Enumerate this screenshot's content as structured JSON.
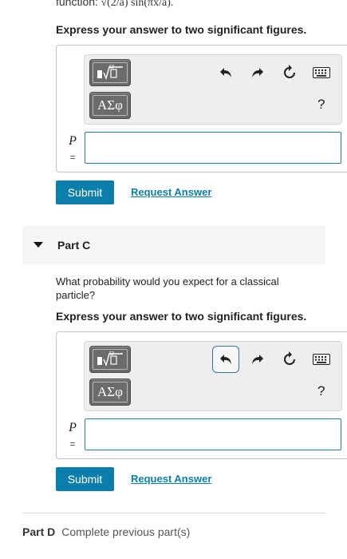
{
  "top_fragment": {
    "prefix": "function:",
    "math": "√(2/a) sin(πx/a)."
  },
  "part_b": {
    "instruction": "Express your answer to two significant figures.",
    "variable": "P",
    "equals": "=",
    "answer_value": "",
    "toolbar": {
      "templates_icon": "templates-icon",
      "symbols_label": "ΑΣφ",
      "help_label": "?"
    },
    "submit_label": "Submit",
    "request_label": "Request Answer"
  },
  "part_c": {
    "title": "Part C",
    "question": "What probability would you expect for a classical particle?",
    "instruction": "Express your answer to two significant figures.",
    "variable": "P",
    "equals": "=",
    "answer_value": "",
    "toolbar": {
      "templates_icon": "templates-icon",
      "symbols_label": "ΑΣφ",
      "help_label": "?"
    },
    "submit_label": "Submit",
    "request_label": "Request Answer"
  },
  "part_d": {
    "title": "Part D",
    "status": "Complete previous part(s)"
  },
  "colors": {
    "accent": "#0c7eab",
    "tool_button": "#6b6b6b",
    "toolbar_bg": "#eeeeee"
  }
}
